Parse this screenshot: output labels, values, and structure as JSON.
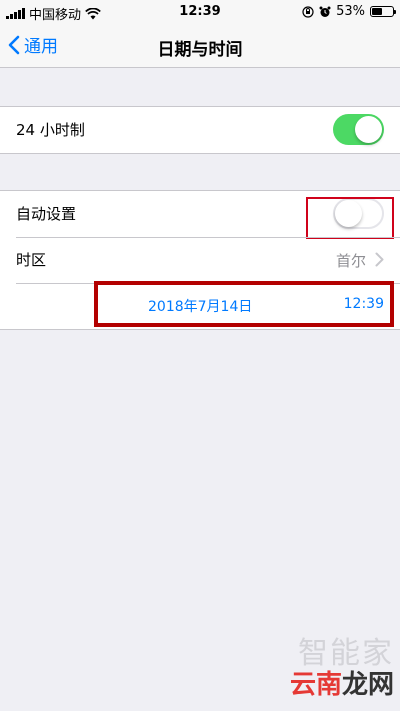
{
  "status_bar": {
    "carrier": "中国移动",
    "time": "12:39",
    "battery_percent": "53%",
    "battery_level": 0.53
  },
  "nav": {
    "back_label": "通用",
    "title": "日期与时间"
  },
  "settings": {
    "hour24": {
      "label": "24 小时制",
      "enabled": true
    },
    "auto_set": {
      "label": "自动设置",
      "enabled": false
    },
    "timezone": {
      "label": "时区",
      "value": "首尔"
    },
    "datetime": {
      "date": "2018年7月14日",
      "time": "12:39"
    }
  },
  "watermark": {
    "line1": "智能家",
    "line2_part1": "云南",
    "line2_part2": "龙网"
  },
  "colors": {
    "accent": "#007aff",
    "switch_on": "#4cd964",
    "highlight": "#d0021b"
  }
}
